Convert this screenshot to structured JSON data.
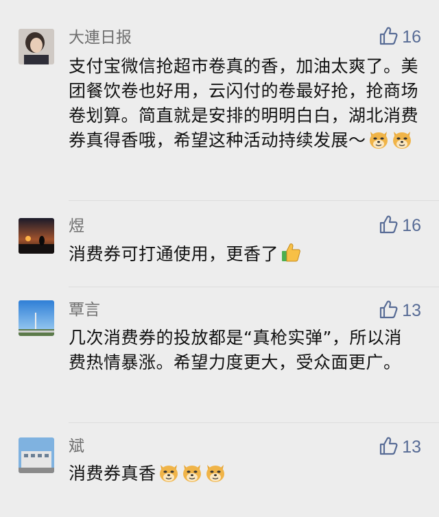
{
  "comments": [
    {
      "author": "大連日报",
      "likes": "16",
      "text": "支付宝微信抢超市卷真的香，加油太爽了。美团餐饮卷也好用，云闪付的卷最好抢，抢商场卷划算。简直就是安排的明明白白，湖北消费券真得香哦，希望这种活动持续发展～",
      "emojis": [
        "doge-emoji",
        "doge-emoji"
      ]
    },
    {
      "author": "煜",
      "likes": "16",
      "text": "消费券可打通使用，更香了",
      "emojis": [
        "thumbs-up-emoji"
      ]
    },
    {
      "author": "覃言",
      "likes": "13",
      "text": "几次消费券的投放都是“真枪实弹”，所以消费热情暴涨。希望力度更大，受众面更广。",
      "emojis": []
    },
    {
      "author": "斌",
      "likes": "13",
      "text": "消费券真香",
      "emojis": [
        "doge-emoji",
        "doge-emoji",
        "doge-emoji"
      ]
    }
  ],
  "colors": {
    "background": "#ededed",
    "name": "#6f6f6f",
    "like_accent": "#576b95",
    "text": "#111111"
  }
}
